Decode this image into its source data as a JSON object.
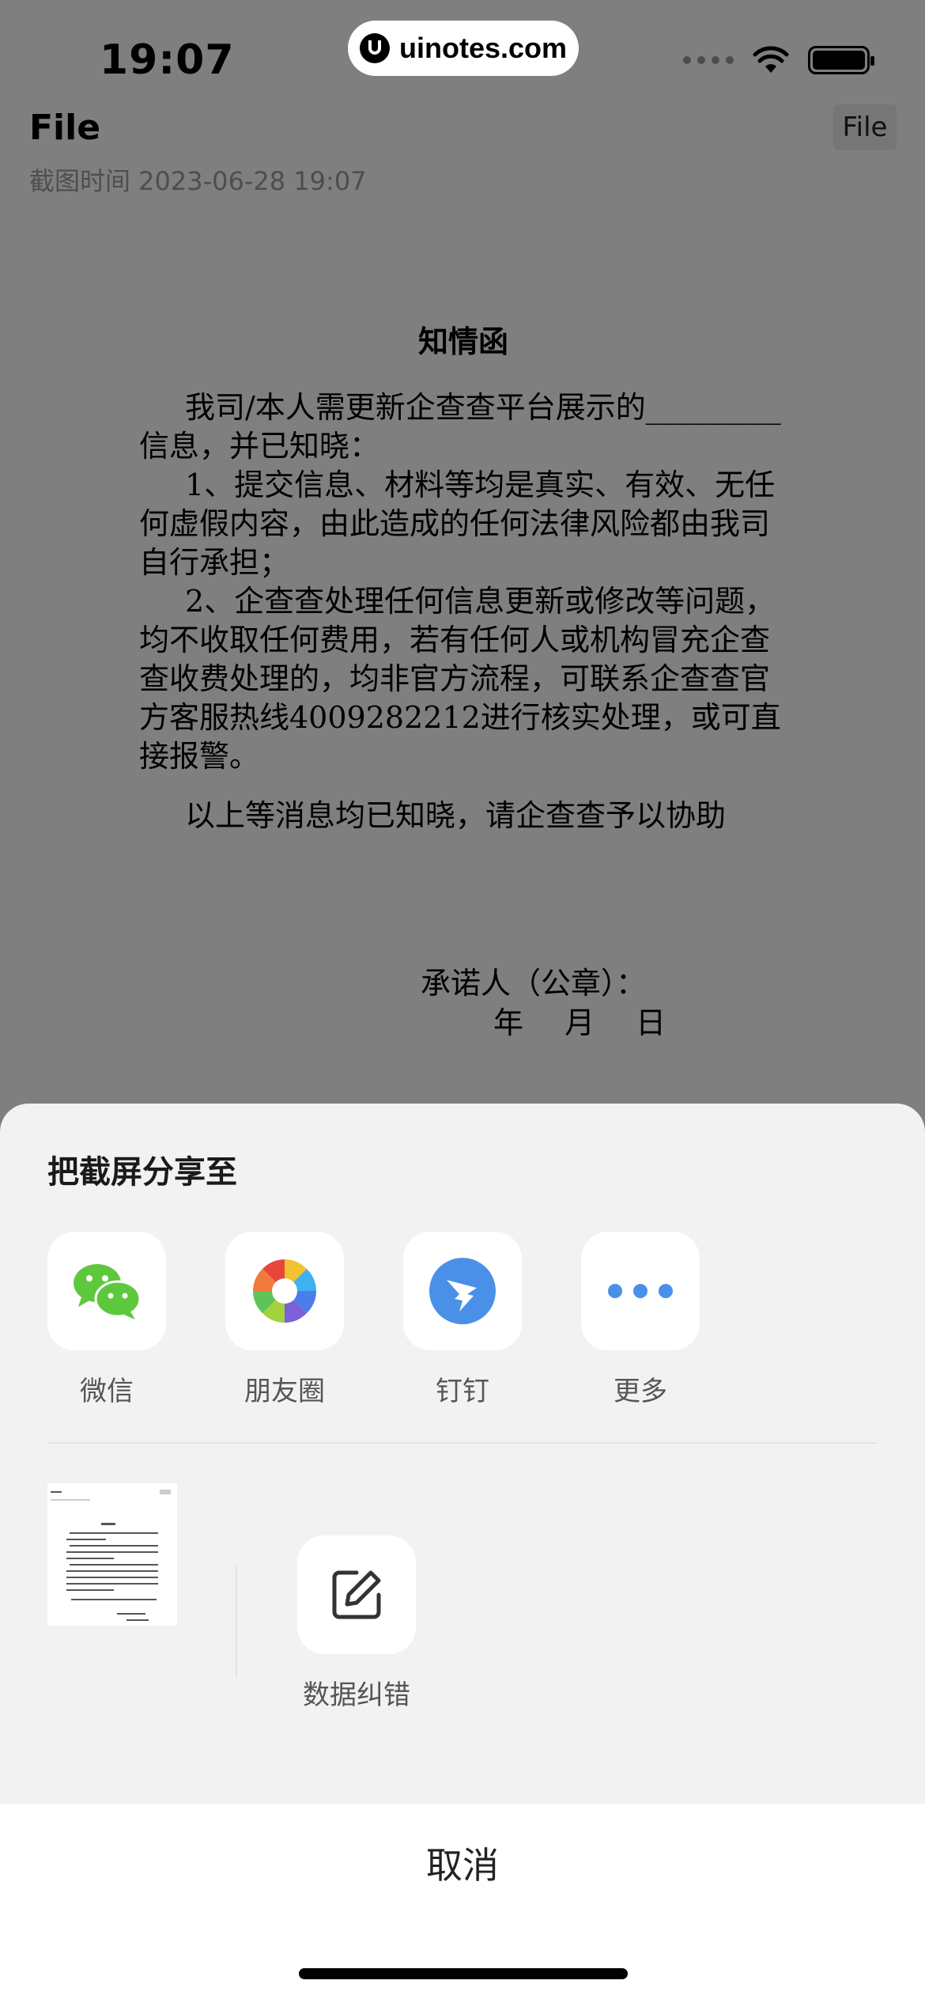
{
  "status_bar": {
    "time": "19:07"
  },
  "watermark": {
    "text": "uinotes.com"
  },
  "header": {
    "title": "File",
    "button_label": "File",
    "capture_time": "截图时间 2023-06-28 19:07"
  },
  "document": {
    "title": "知情函",
    "paragraph1": "我司/本人需更新企查查平台展示的_________信息，并已知晓：",
    "item1": "1、提交信息、材料等均是真实、有效、无任何虚假内容，由此造成的任何法律风险都由我司自行承担；",
    "item2": "2、企查查处理任何信息更新或修改等问题，均不收取任何费用，若有任何人或机构冒充企查查收费处理的，均非官方流程，可联系企查查官方客服热线4009282212进行核实处理，或可直接报警。",
    "closing": "以上等消息均已知晓，请企查查予以协助",
    "signature": "承诺人（公章）：",
    "date": "年 月 日"
  },
  "share_sheet": {
    "title": "把截屏分享至",
    "targets": [
      {
        "label": "微信",
        "icon": "wechat-icon",
        "color": "#5dc83c"
      },
      {
        "label": "朋友圈",
        "icon": "moments-icon",
        "color": "#f0a030"
      },
      {
        "label": "钉钉",
        "icon": "dingtalk-icon",
        "color": "#4a90e8"
      },
      {
        "label": "更多",
        "icon": "more-icon",
        "color": "#4a90e8"
      }
    ],
    "correction_label": "数据纠错",
    "cancel_label": "取消"
  }
}
